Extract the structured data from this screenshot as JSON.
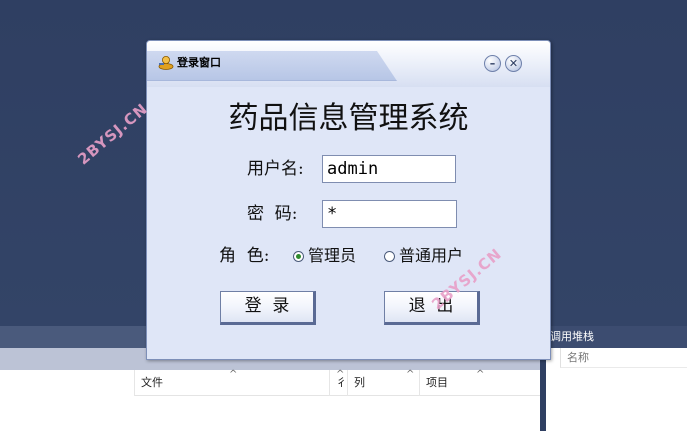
{
  "window": {
    "title": "登录窗口",
    "minimize_glyph": "–",
    "close_glyph": "✕"
  },
  "app": {
    "title": "药品信息管理系统"
  },
  "form": {
    "username_label": "用户名:",
    "username_value": "admin",
    "password_label": "密  码:",
    "password_value": "*",
    "role_label": "角  色:",
    "roles": [
      {
        "label": "管理员",
        "checked": true
      },
      {
        "label": "普通用户",
        "checked": false
      }
    ]
  },
  "buttons": {
    "login_label": "登  录",
    "exit_label": "退  出"
  },
  "background": {
    "columns": [
      "文件",
      "彳",
      "列",
      "项目"
    ],
    "right_panel_title": "调用堆栈",
    "right_panel_column": "名称"
  },
  "watermark": "2BYSJ.CN",
  "colors": {
    "desktop": "#2f3f62",
    "dialog_bg": "#dfe6f7",
    "radio_checked": "#2e8b2e",
    "watermark": "#e8a0c8"
  },
  "icons": {
    "title_icon": "user-key-icon",
    "minimize": "minimize-icon",
    "close": "close-icon",
    "sort": "sort-caret-icon"
  }
}
